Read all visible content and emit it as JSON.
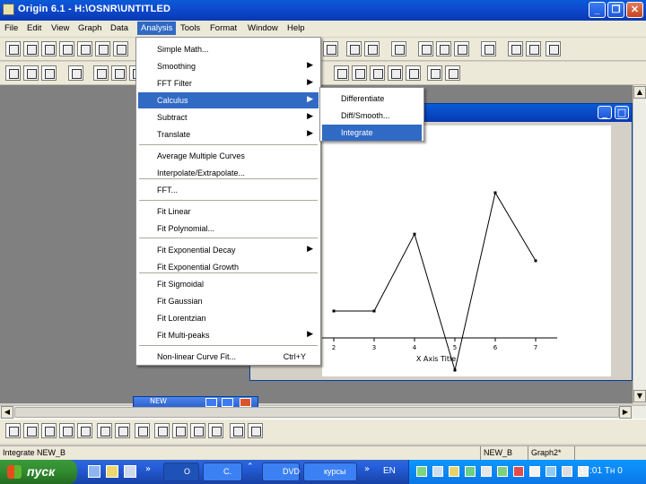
{
  "title": "Origin 6.1 - H:\\OSNR\\UNTITLED",
  "menubar": [
    "File",
    "Edit",
    "View",
    "Graph",
    "Data",
    "Analysis",
    "Tools",
    "Format",
    "Window",
    "Help"
  ],
  "analysis_menu": {
    "items": [
      {
        "label": "Simple Math...",
        "arrow": false
      },
      {
        "label": "Smoothing",
        "arrow": true
      },
      {
        "label": "FFT Filter",
        "arrow": true
      },
      {
        "label": "Calculus",
        "arrow": true,
        "highlighted": true
      },
      {
        "label": "Subtract",
        "arrow": true
      },
      {
        "label": "Translate",
        "arrow": true
      },
      {
        "label": "Average Multiple Curves",
        "arrow": false
      },
      {
        "label": "Interpolate/Extrapolate...",
        "arrow": false
      },
      {
        "label": "FFT...",
        "arrow": false
      },
      {
        "label": "Fit Linear",
        "arrow": false
      },
      {
        "label": "Fit Polynomial...",
        "arrow": false
      },
      {
        "label": "Fit Exponential Decay",
        "arrow": true
      },
      {
        "label": "Fit Exponential Growth",
        "arrow": false
      },
      {
        "label": "Fit Sigmoidal",
        "arrow": false
      },
      {
        "label": "Fit Gaussian",
        "arrow": false
      },
      {
        "label": "Fit Lorentzian",
        "arrow": false
      },
      {
        "label": "Fit Multi-peaks",
        "arrow": true
      },
      {
        "label": "Non-linear Curve Fit...",
        "arrow": false,
        "shortcut": "Ctrl+Y"
      }
    ]
  },
  "calculus_submenu": [
    "Differentiate",
    "Diff/Smooth...",
    "Integrate"
  ],
  "graph": {
    "xlabel": "X Axis Title",
    "xticks": [
      "2",
      "3",
      "4",
      "5",
      "6",
      "7"
    ]
  },
  "chart_data": {
    "type": "line",
    "x": [
      2,
      3,
      4,
      5,
      6,
      7
    ],
    "y": [
      3,
      3,
      5.6,
      1,
      7,
      4.7
    ],
    "xlabel": "X Axis Title"
  },
  "mdi_window": "NEW",
  "statusbar": {
    "message": "Integrate NEW_B",
    "dataset": "NEW_B",
    "page": "Graph2*"
  },
  "taskbar": {
    "start": "пуск",
    "tasks": [
      {
        "label": "O"
      },
      {
        "label": "C."
      },
      {
        "label": "DVD"
      },
      {
        "label": "курсы"
      }
    ],
    "lang": "EN",
    "clock": "17:01 Тн 0"
  }
}
